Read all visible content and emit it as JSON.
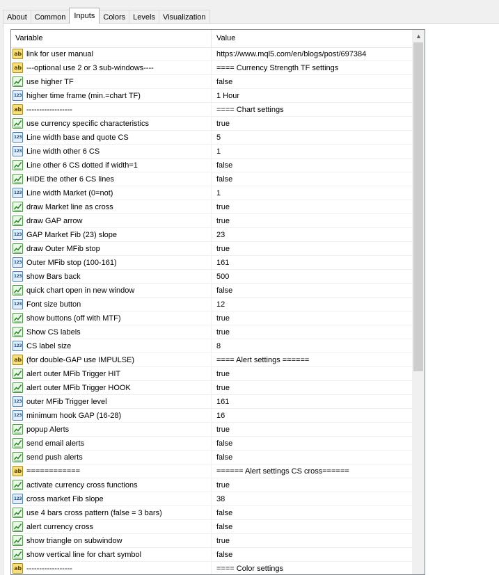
{
  "tabs": [
    {
      "label": "About"
    },
    {
      "label": "Common"
    },
    {
      "label": "Inputs",
      "active": true
    },
    {
      "label": "Colors"
    },
    {
      "label": "Levels"
    },
    {
      "label": "Visualization"
    }
  ],
  "table": {
    "columns": {
      "variable": "Variable",
      "value": "Value"
    },
    "rows": [
      {
        "type": "string",
        "variable": "link for user manual",
        "value": "https://www.mql5.com/en/blogs/post/697384"
      },
      {
        "type": "string",
        "variable": "---optional use 2 or 3 sub-windows----",
        "value": "==== Currency Strength TF settings"
      },
      {
        "type": "bool",
        "variable": "use higher TF",
        "value": "false"
      },
      {
        "type": "number",
        "variable": "higher time frame (min.=chart TF)",
        "value": "1 Hour"
      },
      {
        "type": "string",
        "variable": "------------------",
        "value": "==== Chart settings"
      },
      {
        "type": "bool",
        "variable": "use currency specific characteristics",
        "value": "true"
      },
      {
        "type": "number",
        "variable": "Line width base and quote CS",
        "value": "5"
      },
      {
        "type": "number",
        "variable": "Line width other 6 CS",
        "value": "1"
      },
      {
        "type": "bool",
        "variable": "Line other 6 CS dotted if width=1",
        "value": "false"
      },
      {
        "type": "bool",
        "variable": "HIDE the other 6 CS lines",
        "value": "false"
      },
      {
        "type": "number",
        "variable": "Line width Market (0=not)",
        "value": "1"
      },
      {
        "type": "bool",
        "variable": "draw Market line as cross",
        "value": "true"
      },
      {
        "type": "bool",
        "variable": "draw GAP arrow",
        "value": "true"
      },
      {
        "type": "number",
        "variable": "GAP Market Fib (23) slope",
        "value": "23"
      },
      {
        "type": "bool",
        "variable": "draw Outer MFib stop",
        "value": "true"
      },
      {
        "type": "number",
        "variable": "Outer MFib stop (100-161)",
        "value": "161"
      },
      {
        "type": "number",
        "variable": "show Bars back",
        "value": "500"
      },
      {
        "type": "bool",
        "variable": "quick chart open in new window",
        "value": "false"
      },
      {
        "type": "number",
        "variable": "Font size button",
        "value": "12"
      },
      {
        "type": "bool",
        "variable": "show buttons (off with MTF)",
        "value": "true"
      },
      {
        "type": "bool",
        "variable": "Show CS labels",
        "value": "true"
      },
      {
        "type": "number",
        "variable": "CS label size",
        "value": "8"
      },
      {
        "type": "string",
        "variable": "(for double-GAP use IMPULSE)",
        "value": "==== Alert settings ======"
      },
      {
        "type": "bool",
        "variable": "alert outer MFib Trigger HIT",
        "value": "true"
      },
      {
        "type": "bool",
        "variable": "alert outer MFib Trigger HOOK",
        "value": "true"
      },
      {
        "type": "number",
        "variable": "outer MFib Trigger level",
        "value": "161"
      },
      {
        "type": "number",
        "variable": "minimum hook GAP (16-28)",
        "value": "16"
      },
      {
        "type": "bool",
        "variable": "popup Alerts",
        "value": "true"
      },
      {
        "type": "bool",
        "variable": "send email alerts",
        "value": "false"
      },
      {
        "type": "bool",
        "variable": "send push alerts",
        "value": "false"
      },
      {
        "type": "string",
        "variable": "============",
        "value": "====== Alert settings CS cross======"
      },
      {
        "type": "bool",
        "variable": "activate currency cross functions",
        "value": "true"
      },
      {
        "type": "number",
        "variable": "cross market Fib slope",
        "value": "38"
      },
      {
        "type": "bool",
        "variable": "use 4 bars cross pattern (false = 3 bars)",
        "value": "false"
      },
      {
        "type": "bool",
        "variable": "alert currency cross",
        "value": "false"
      },
      {
        "type": "bool",
        "variable": "show triangle on subwindow",
        "value": "true"
      },
      {
        "type": "bool",
        "variable": "show vertical line for chart symbol",
        "value": "false"
      },
      {
        "type": "string",
        "variable": "------------------",
        "value": "==== Color settings"
      }
    ]
  },
  "icons": {
    "string": "ab",
    "number": "123",
    "bool": "bool-icon"
  },
  "scrollbar": {
    "up_arrow": "▲"
  }
}
